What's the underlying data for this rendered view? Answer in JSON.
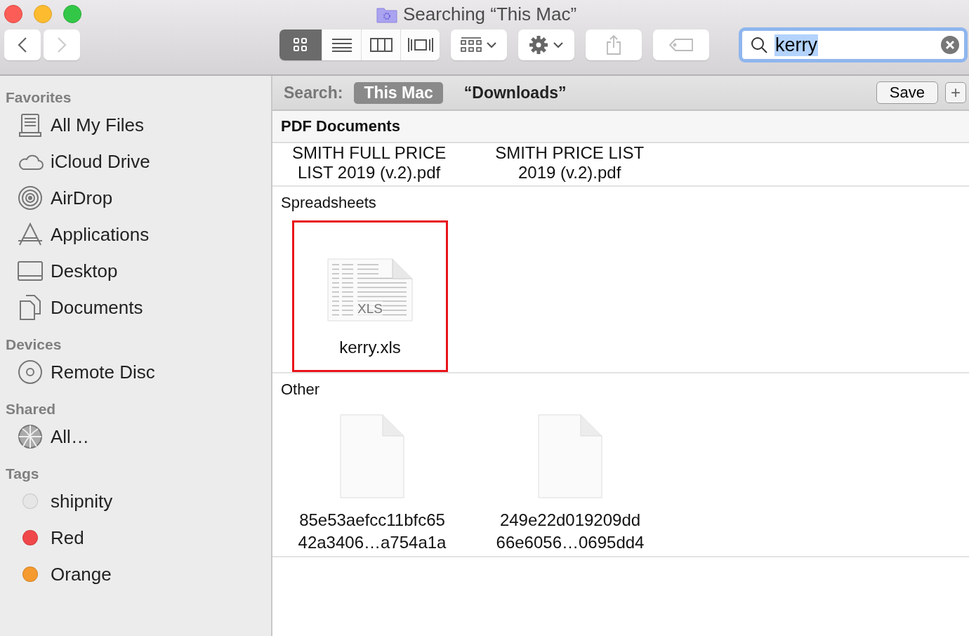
{
  "window": {
    "title": "Searching “This Mac”"
  },
  "toolbar": {
    "back": {
      "disabled": false
    },
    "forward": {
      "disabled": true
    },
    "views": [
      {
        "kind": "icon",
        "selected": true
      },
      {
        "kind": "list",
        "selected": false
      },
      {
        "kind": "columns",
        "selected": false
      },
      {
        "kind": "coverflow",
        "selected": false
      }
    ]
  },
  "search": {
    "value": "kerry",
    "selected_text": true
  },
  "sidebar": [
    {
      "heading": "Favorites",
      "items": [
        {
          "label": "All My Files",
          "kind": "files"
        },
        {
          "label": "iCloud Drive",
          "kind": "cloud"
        },
        {
          "label": "AirDrop",
          "kind": "airdrop"
        },
        {
          "label": "Applications",
          "kind": "apps"
        },
        {
          "label": "Desktop",
          "kind": "desktop"
        },
        {
          "label": "Documents",
          "kind": "documents"
        }
      ]
    },
    {
      "heading": "Devices",
      "items": [
        {
          "label": "Remote Disc",
          "kind": "disc"
        }
      ]
    },
    {
      "heading": "Shared",
      "items": [
        {
          "label": "All…",
          "kind": "network"
        }
      ]
    },
    {
      "heading": "Tags",
      "items": [
        {
          "label": "shipnity",
          "kind": "tag",
          "color": "#e6e6e6"
        },
        {
          "label": "Red",
          "kind": "tag",
          "color": "#f0474a"
        },
        {
          "label": "Orange",
          "kind": "tag",
          "color": "#f59a2f"
        }
      ]
    }
  ],
  "scope_bar": {
    "label": "Search:",
    "scopes": [
      {
        "label": "This Mac",
        "selected": true
      },
      {
        "label": "“Downloads”",
        "selected": false
      }
    ],
    "save": "Save",
    "add": "+"
  },
  "groups": [
    {
      "title": "PDF Documents",
      "files": [
        {
          "name_lines": [
            "SMITH FULL PRICE",
            "LIST 2019 (v.2).pdf"
          ],
          "selected": false
        },
        {
          "name_lines": [
            "SMITH PRICE LIST",
            "2019 (v.2).pdf"
          ],
          "selected": false
        }
      ]
    },
    {
      "title": "Spreadsheets",
      "files": [
        {
          "kind": "xls",
          "name_lines": [
            "kerry.xls"
          ],
          "badge": "XLS",
          "selected": true
        }
      ]
    },
    {
      "title": "Other",
      "files": [
        {
          "kind": "blank",
          "name_lines": [
            "85e53aefcc11bfc65",
            "42a3406…a754a1a"
          ],
          "selected": false
        },
        {
          "kind": "blank",
          "name_lines": [
            "249e22d019209dd",
            "66e6056…0695dd4"
          ],
          "selected": false
        }
      ]
    }
  ]
}
